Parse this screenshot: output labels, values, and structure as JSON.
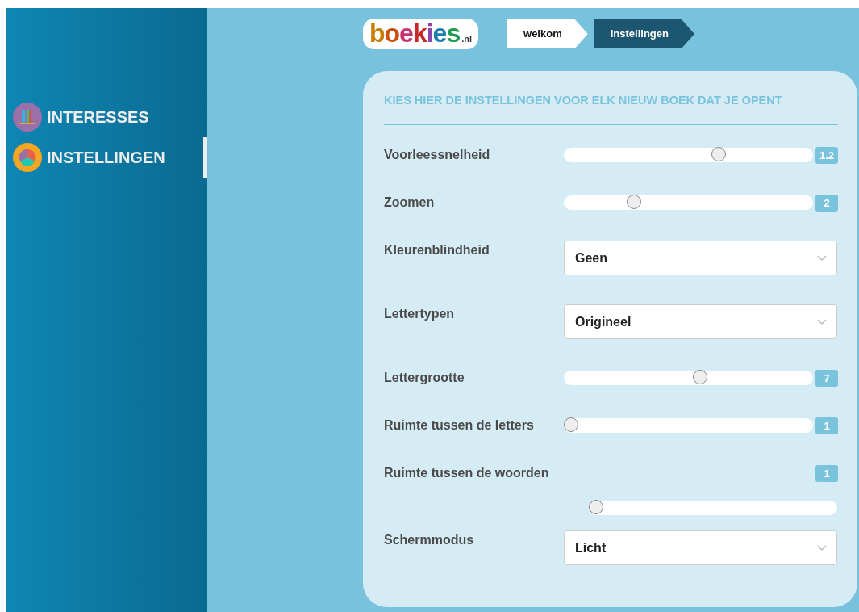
{
  "sidebar": {
    "items": [
      {
        "label": "INTERESSES",
        "selected": false
      },
      {
        "label": "INSTELLINGEN",
        "selected": true
      }
    ]
  },
  "header": {
    "logo": "boekies",
    "logo_suffix": ".nl",
    "breadcrumb": [
      {
        "label": "welkom",
        "selected": false
      },
      {
        "label": "Instellingen",
        "selected": true
      }
    ]
  },
  "settings": {
    "title": "KIES HIER DE INSTELLINGEN VOOR ELK NIEUW BOEK DAT JE OPENT",
    "rows": [
      {
        "kind": "slider",
        "label": "Voorleessnelheid",
        "level": 0.63,
        "reading": "1.2"
      },
      {
        "kind": "slider",
        "label": "Zoomen",
        "level": 0.27,
        "reading": "2"
      },
      {
        "kind": "select",
        "label": "Kleurenblindheid",
        "value": "Geen"
      },
      {
        "kind": "select",
        "label": "Lettertypen",
        "value": "Origineel"
      },
      {
        "kind": "slider",
        "label": "Lettergrootte",
        "level": 0.55,
        "reading": "7"
      },
      {
        "kind": "slider",
        "label": "Ruimte tussen de letters",
        "level": 0,
        "reading": "1"
      },
      {
        "kind": "stacked",
        "label": "Ruimte tussen de woorden",
        "level": 0,
        "reading": "1"
      },
      {
        "kind": "select",
        "label": "Schermmodus",
        "value": "Licht"
      }
    ]
  }
}
